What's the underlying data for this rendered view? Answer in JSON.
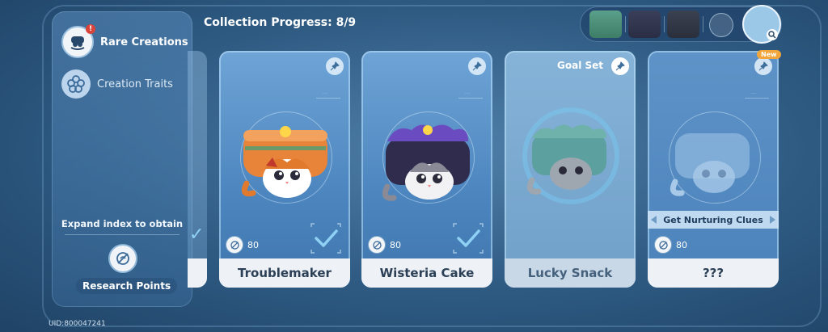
{
  "header": {
    "progress_title": "Collection Progress: 8/9"
  },
  "sidebar": {
    "items": [
      {
        "label": "Rare Creations",
        "icon": "creature-icon",
        "active": true,
        "badge": "!"
      },
      {
        "label": "Creation Traits",
        "icon": "flower-icon",
        "active": false
      }
    ],
    "expand_text": "Expand index to obtain",
    "research_label": "Research Points"
  },
  "footer": {
    "uid": "UID:800047241"
  },
  "cards": [
    {
      "name": "Troublemaker",
      "points": "80",
      "collected": true,
      "pinned": false
    },
    {
      "name": "Wisteria Cake",
      "points": "80",
      "collected": true,
      "pinned": false
    },
    {
      "name": "Lucky Snack",
      "points": "",
      "collected": false,
      "goal_label": "Goal Set"
    },
    {
      "name": "???",
      "points": "80",
      "collected": false,
      "new_badge": "New",
      "clue_label": "Get Nurturing Clues"
    }
  ],
  "colors": {
    "accent": "#2f5f8a",
    "card_name_bg": "#eef2f6",
    "check": "#8fd0f5",
    "badge_new": "#f2a53a",
    "alert": "#d9443a"
  }
}
